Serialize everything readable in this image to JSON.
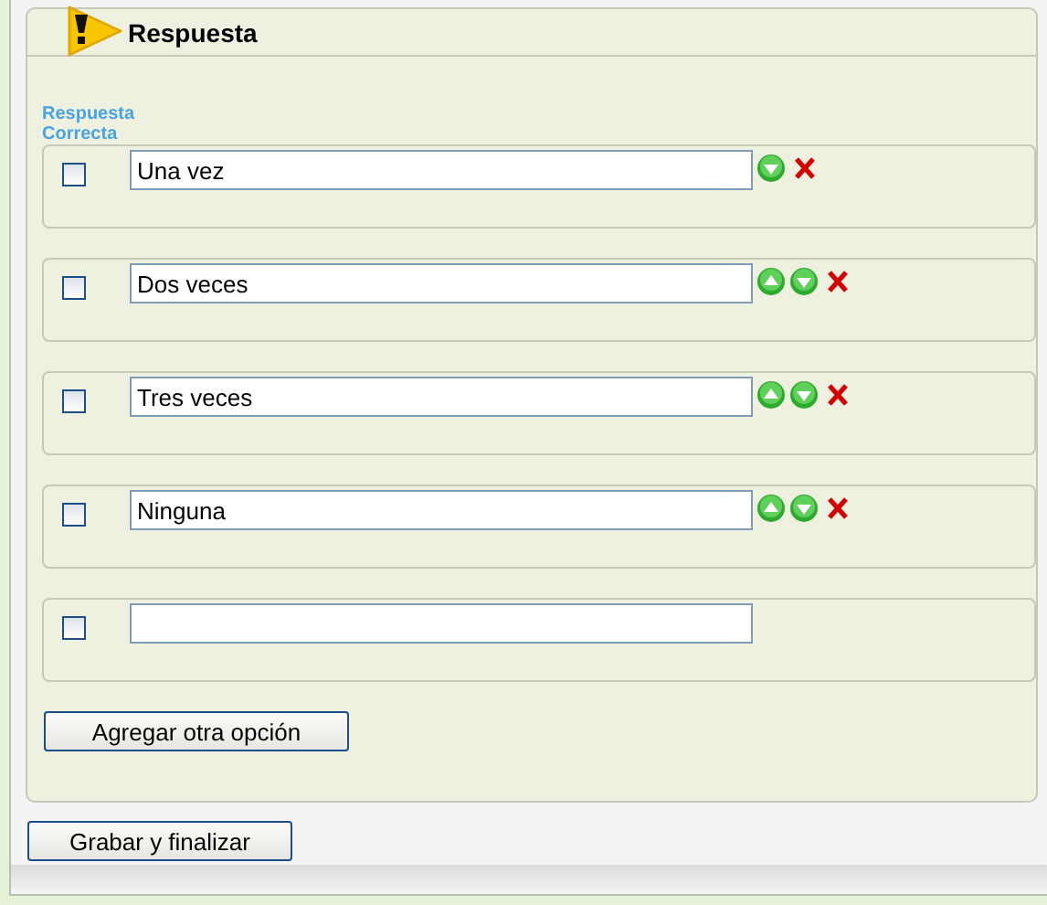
{
  "section": {
    "title": "Respuesta"
  },
  "column_label": "Respuesta Correcta",
  "options": [
    {
      "value": "Una vez",
      "checked": false,
      "can_move_up": false,
      "can_move_down": true,
      "removable": true
    },
    {
      "value": "Dos veces",
      "checked": false,
      "can_move_up": true,
      "can_move_down": true,
      "removable": true
    },
    {
      "value": "Tres veces",
      "checked": false,
      "can_move_up": true,
      "can_move_down": true,
      "removable": true
    },
    {
      "value": "Ninguna",
      "checked": false,
      "can_move_up": true,
      "can_move_down": true,
      "removable": true
    },
    {
      "checked": false,
      "can_move_up": false,
      "can_move_down": false,
      "removable": false
    }
  ],
  "add_button": "Agregar otra opción",
  "save_button": "Grabar y finalizar"
}
